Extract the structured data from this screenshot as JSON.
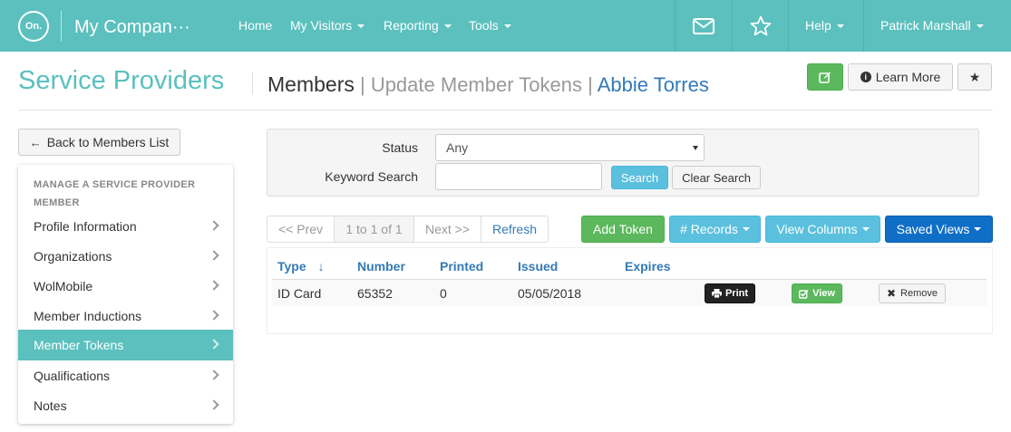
{
  "navbar": {
    "logo_text": "On.",
    "brand": "My Compan···",
    "items": [
      {
        "label": "Home"
      },
      {
        "label": "My Visitors"
      },
      {
        "label": "Reporting"
      },
      {
        "label": "Tools"
      }
    ],
    "help": "Help",
    "user": "Patrick Marshall",
    "bg_color": "#5bc0be"
  },
  "header": {
    "title": "Service Providers",
    "crumb_section": "Members",
    "crumb_sep1": " | ",
    "crumb_page": "Update Member Tokens",
    "crumb_sep2": " | ",
    "crumb_person": "Abbie Torres",
    "learn_more": "Learn More"
  },
  "sidebar": {
    "back_label": "Back to Members List",
    "heading": "Manage a Service Provider Member",
    "items": [
      {
        "label": "Profile Information"
      },
      {
        "label": "Organizations"
      },
      {
        "label": "WolMobile"
      },
      {
        "label": "Member Inductions"
      },
      {
        "label": "Member Tokens"
      },
      {
        "label": "Qualifications"
      },
      {
        "label": "Notes"
      }
    ],
    "active_item": "Member Tokens"
  },
  "search": {
    "status_label": "Status",
    "status_value": "Any",
    "keyword_label": "Keyword Search",
    "keyword_value": "",
    "search_btn": "Search",
    "clear_btn": "Clear Search"
  },
  "pager": {
    "prev": "<< Prev",
    "info": "1 to 1 of 1",
    "next": "Next >>",
    "refresh": "Refresh"
  },
  "toolbar": {
    "add_token": "Add Token",
    "records": "# Records",
    "view_columns": "View Columns",
    "saved_views": "Saved Views"
  },
  "table": {
    "headers": {
      "type": "Type",
      "number": "Number",
      "printed": "Printed",
      "issued": "Issued",
      "expires": "Expires"
    },
    "sort_column": "Type",
    "rows": [
      {
        "type": "ID Card",
        "number": "65352",
        "printed": "0",
        "issued": "05/05/2018",
        "expires": "",
        "print_btn": "Print",
        "view_btn": "View",
        "remove_btn": "Remove"
      }
    ]
  }
}
